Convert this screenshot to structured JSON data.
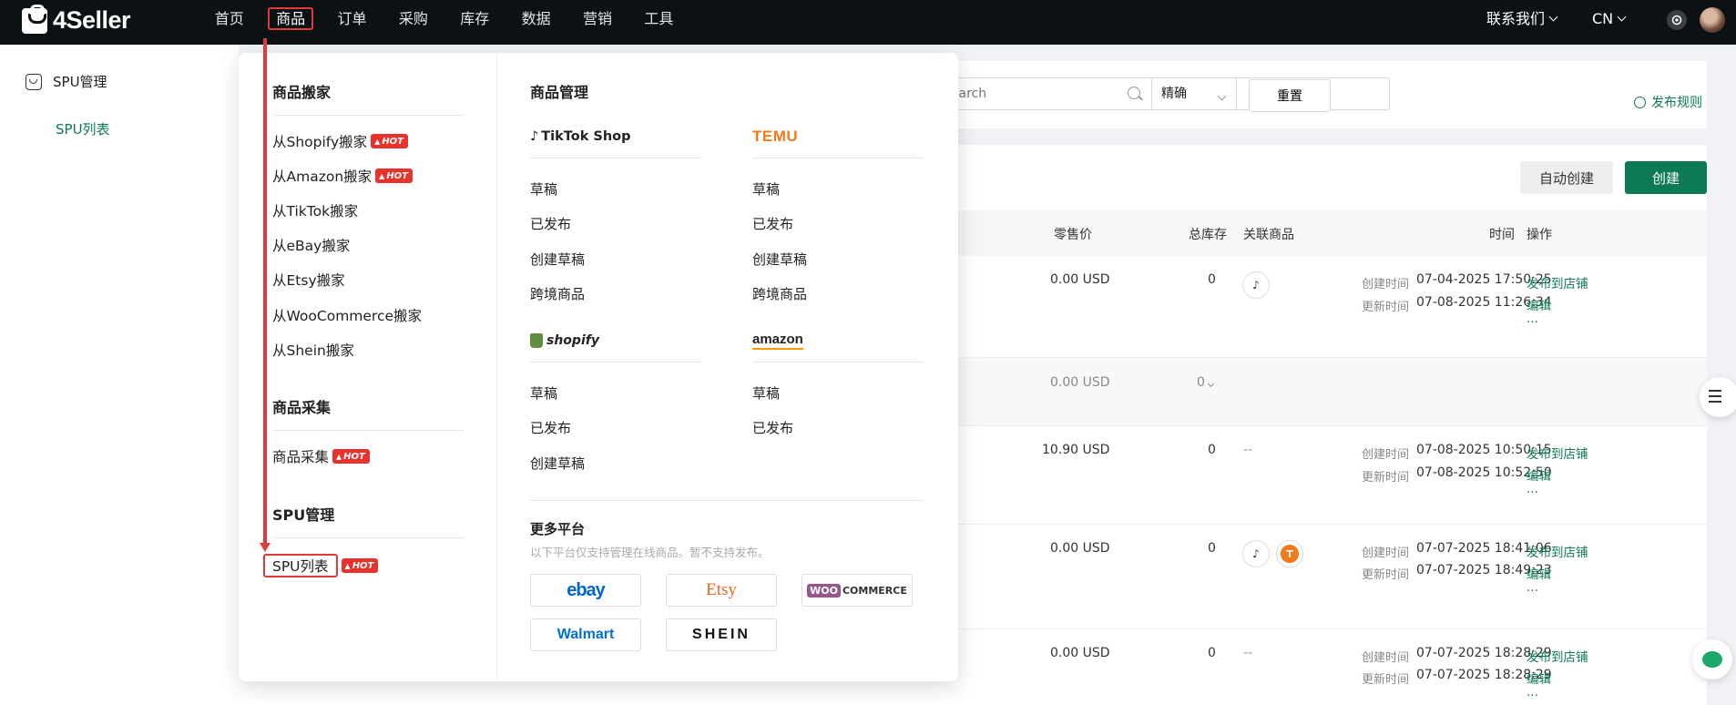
{
  "app": {
    "logo": "4Seller"
  },
  "nav": {
    "items": [
      "首页",
      "商品",
      "订单",
      "采购",
      "库存",
      "数据",
      "营销",
      "工具"
    ],
    "active_index": 1,
    "contact": "联系我们",
    "lang": "CN"
  },
  "sidebar": {
    "group": "SPU管理",
    "sub": "SPU列表"
  },
  "filter": {
    "search_placeholder": "Search",
    "match": "精确",
    "reset": "重置",
    "rule_link": "发布规则"
  },
  "toolbar": {
    "auto_create": "自动创建",
    "create": "创建"
  },
  "table": {
    "headers": {
      "price": "零售价",
      "stock": "总库存",
      "linked": "关联商品",
      "time": "时间",
      "ops": "操作"
    },
    "created_label": "创建时间",
    "updated_label": "更新时间",
    "publish_label": "发布到店铺",
    "edit_label": "编辑",
    "more_label": "...",
    "rows": [
      {
        "price": "0.00 USD",
        "stock": "0",
        "linked": "tiktok",
        "created": "07-04-2025 17:50:25",
        "updated": "07-08-2025 11:26:34"
      },
      {
        "price": "0.00 USD",
        "stock": "0",
        "sub": true
      },
      {
        "price": "10.90 USD",
        "stock": "0",
        "linked_text": "--",
        "created": "07-08-2025 10:50:15",
        "updated": "07-08-2025 10:52:50"
      },
      {
        "price": "0.00 USD",
        "stock": "0",
        "linked": "tiktok+temu",
        "created": "07-07-2025 18:41:06",
        "updated": "07-07-2025 18:49:23"
      },
      {
        "price": "0.00 USD",
        "stock": "0",
        "linked_text": "--",
        "created": "07-07-2025 18:28:29",
        "updated": "07-07-2025 18:28:29"
      }
    ]
  },
  "mega_menu": {
    "col1": {
      "move": {
        "title": "商品搬家",
        "items": [
          {
            "label": "从Shopify搬家",
            "hot": true
          },
          {
            "label": "从Amazon搬家",
            "hot": true
          },
          {
            "label": "从TikTok搬家"
          },
          {
            "label": "从eBay搬家"
          },
          {
            "label": "从Etsy搬家"
          },
          {
            "label": "从WooCommerce搬家"
          },
          {
            "label": "从Shein搬家"
          }
        ]
      },
      "collect": {
        "title": "商品采集",
        "item": "商品采集"
      },
      "spu": {
        "title": "SPU管理",
        "item": "SPU列表"
      },
      "hot": "HOT"
    },
    "col2": {
      "title": "商品管理",
      "tiktok": {
        "logo": "TikTok Shop",
        "items": [
          "草稿",
          "已发布",
          "创建草稿",
          "跨境商品"
        ]
      },
      "temu": {
        "logo": "TEMU",
        "items": [
          "草稿",
          "已发布",
          "创建草稿",
          "跨境商品"
        ]
      },
      "shopify": {
        "logo": "shopify",
        "items": [
          "草稿",
          "已发布",
          "创建草稿"
        ]
      },
      "amazon": {
        "logo": "amazon",
        "items": [
          "草稿",
          "已发布"
        ]
      },
      "more": {
        "title": "更多平台",
        "desc": "以下平台仅支持管理在线商品。暂不支持发布。",
        "platforms": {
          "ebay": "ebay",
          "etsy": "Etsy",
          "woo": "COMMERCE",
          "woo_prefix": "WOO",
          "walmart": "Walmart",
          "shein": "SHEIN"
        }
      }
    }
  },
  "colors": {
    "brand": "#0e7a55",
    "topbar": "#0c1114",
    "hot": "#e8322b",
    "highlight": "#e03b3b"
  }
}
